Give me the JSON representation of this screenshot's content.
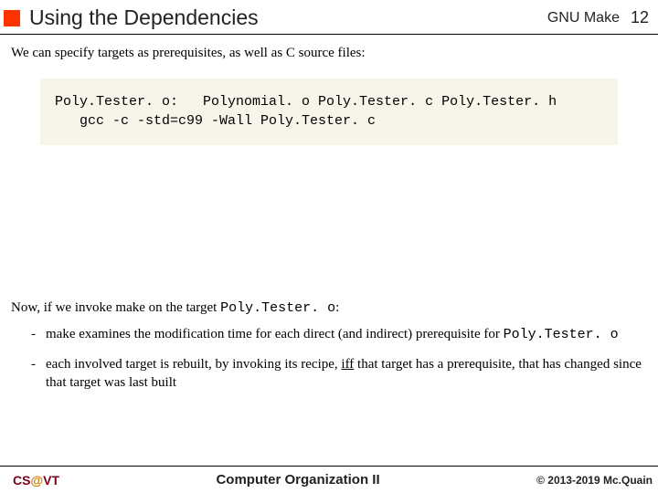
{
  "header": {
    "title": "Using the Dependencies",
    "doc": "GNU Make",
    "page": "12"
  },
  "intro": "We can specify targets as prerequisites, as well as C source files:",
  "code": "Poly.Tester. o:   Polynomial. o Poly.Tester. c Poly.Tester. h\n   gcc -c -std=c99 -Wall Poly.Tester. c",
  "now_prefix": "Now, if we invoke make on the target ",
  "now_target": "Poly.Tester. o",
  "now_suffix": ":",
  "bullets": [
    {
      "pre": "make examines the modification time for each direct (and indirect) prerequisite for ",
      "mono": "Poly.Tester. o",
      "post": ""
    },
    {
      "pre": "each involved target is rebuilt, by invoking its recipe, ",
      "iff": "iff",
      "post": " that target has a prerequisite, that has changed since that target was last built"
    }
  ],
  "footer": {
    "left_cs": "CS",
    "left_at": "@",
    "left_vt": "VT",
    "center": "Computer Organization II",
    "right": "© 2013-2019 Mc.Quain"
  }
}
